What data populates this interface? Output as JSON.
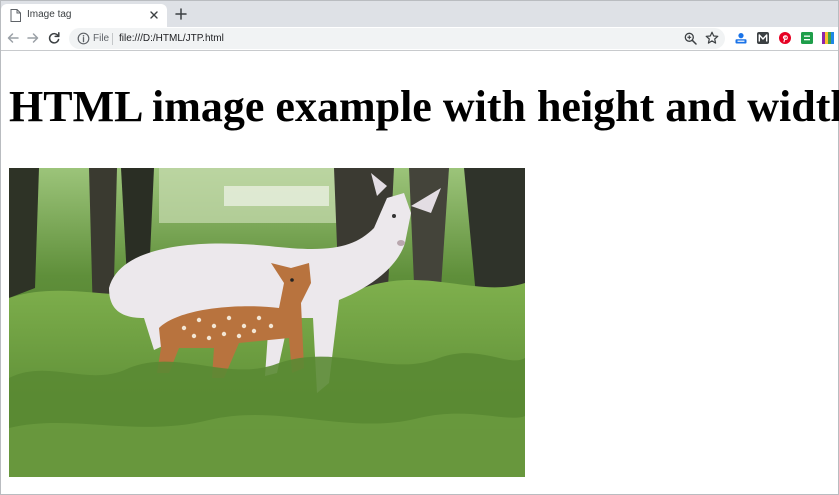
{
  "browser": {
    "tab": {
      "title": "Image tag",
      "icon": "page-icon"
    },
    "new_tab_icon": "plus-icon",
    "address": {
      "scheme_chip": "File",
      "url": "file:///D:/HTML/JTP.html"
    },
    "extensions": [
      {
        "icon": "user-upload-icon",
        "color": "#1a73e8"
      },
      {
        "icon": "m-logo-icon",
        "color": "#3c4043"
      },
      {
        "icon": "pinterest-icon",
        "color": "#e60023"
      },
      {
        "icon": "green-square-icon",
        "color": "#1e9e4a"
      },
      {
        "icon": "color-bars-icon",
        "color": "#8e24aa"
      }
    ]
  },
  "page": {
    "heading": "HTML image example with height and width",
    "image": {
      "description_icon": "deer-photo"
    }
  }
}
